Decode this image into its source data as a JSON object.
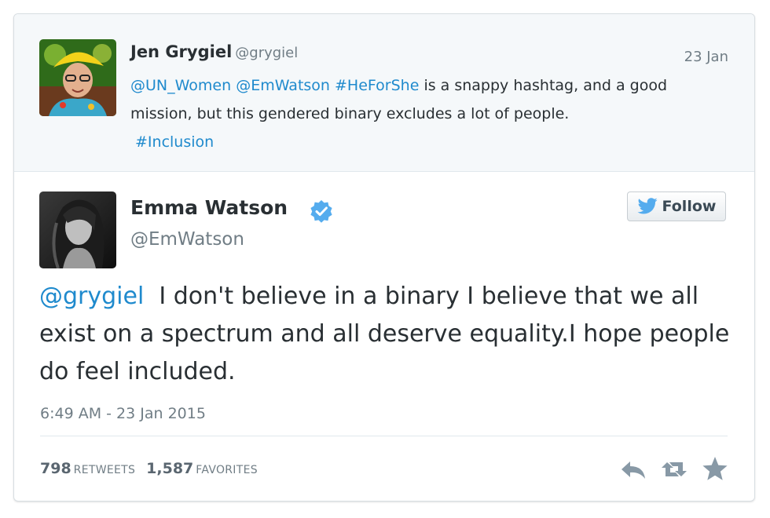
{
  "parent_tweet": {
    "name": "Jen Grygiel",
    "handle": "@grygiel",
    "date": "23 Jan",
    "mentions": [
      "@UN_Women",
      "@EmWatson"
    ],
    "hashtag1": "#HeForShe",
    "text_part1": " is a snappy hashtag, and a good mission, but this gendered binary excludes a lot of people.",
    "hashtag2": "#Inclusion"
  },
  "main_tweet": {
    "name": "Emma Watson",
    "handle": "@EmWatson",
    "verified": true,
    "follow_label": "Follow",
    "mention": "@grygiel",
    "text": "  I don't believe in a binary I believe that we all exist on a spectrum and all deserve equality.I hope people do feel included.",
    "timestamp": "6:49 AM - 23 Jan 2015",
    "retweets_count": "798",
    "retweets_label": "RETWEETS",
    "favorites_count": "1,587",
    "favorites_label": "FAVORITES"
  },
  "icons": {
    "follow": "twitter-bird-icon",
    "reply": "reply-icon",
    "retweet": "retweet-icon",
    "favorite": "star-icon",
    "verified": "verified-badge-icon"
  },
  "colors": {
    "link": "#1f8acd",
    "verified": "#55acee",
    "bird": "#55acee",
    "text": "#292f33",
    "muted": "#707d85"
  }
}
